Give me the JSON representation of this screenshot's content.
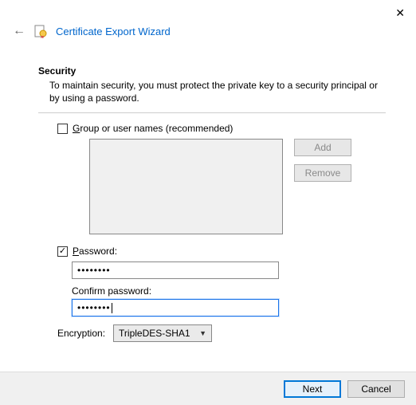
{
  "window": {
    "title": "Certificate Export Wizard"
  },
  "section": {
    "title": "Security",
    "description": "To maintain security, you must protect the private key to a security principal or by using a password."
  },
  "group_option": {
    "label": "Group or user names (recommended)",
    "checked": false
  },
  "buttons": {
    "add": "Add",
    "remove": "Remove"
  },
  "password_option": {
    "label": "Password:",
    "checked": true,
    "value_mask": "••••••••",
    "confirm_label": "Confirm password:",
    "confirm_value_mask": "••••••••"
  },
  "encryption": {
    "label": "Encryption:",
    "selected": "TripleDES-SHA1"
  },
  "footer": {
    "next": "Next",
    "cancel": "Cancel"
  }
}
